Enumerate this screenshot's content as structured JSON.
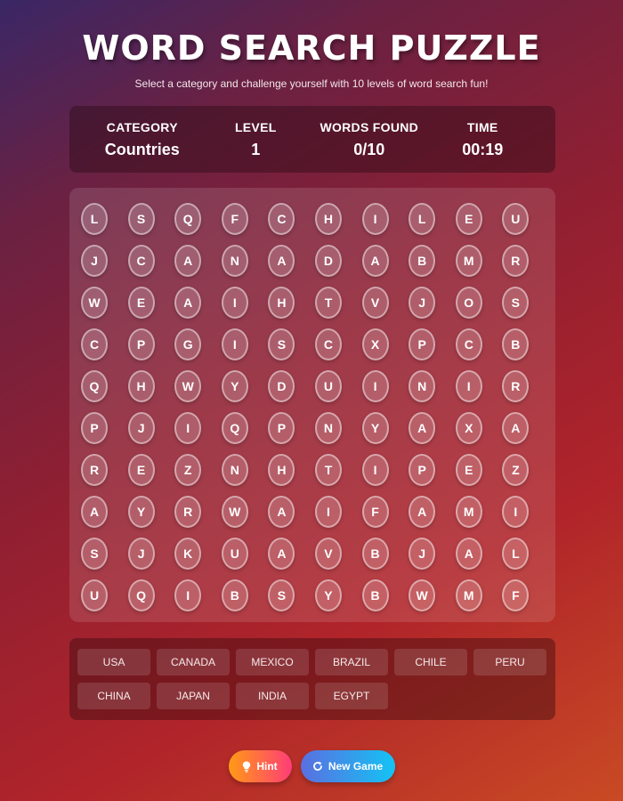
{
  "header": {
    "title": "WORD SEARCH PUZZLE",
    "subtitle": "Select a category and challenge yourself with 10 levels of word search fun!"
  },
  "stats": {
    "category_label": "CATEGORY",
    "category_value": "Countries",
    "level_label": "LEVEL",
    "level_value": "1",
    "words_found_label": "WORDS FOUND",
    "words_found_value": "0/10",
    "time_label": "TIME",
    "time_value": "00:19"
  },
  "grid": [
    [
      "L",
      "S",
      "Q",
      "F",
      "C",
      "H",
      "I",
      "L",
      "E",
      "U"
    ],
    [
      "J",
      "C",
      "A",
      "N",
      "A",
      "D",
      "A",
      "B",
      "M",
      "R"
    ],
    [
      "W",
      "E",
      "A",
      "I",
      "H",
      "T",
      "V",
      "J",
      "O",
      "S"
    ],
    [
      "C",
      "P",
      "G",
      "I",
      "S",
      "C",
      "X",
      "P",
      "C",
      "B"
    ],
    [
      "Q",
      "H",
      "W",
      "Y",
      "D",
      "U",
      "I",
      "N",
      "I",
      "R"
    ],
    [
      "P",
      "J",
      "I",
      "Q",
      "P",
      "N",
      "Y",
      "A",
      "X",
      "A"
    ],
    [
      "R",
      "E",
      "Z",
      "N",
      "H",
      "T",
      "I",
      "P",
      "E",
      "Z"
    ],
    [
      "A",
      "Y",
      "R",
      "W",
      "A",
      "I",
      "F",
      "A",
      "M",
      "I"
    ],
    [
      "S",
      "J",
      "K",
      "U",
      "A",
      "V",
      "B",
      "J",
      "A",
      "L"
    ],
    [
      "U",
      "Q",
      "I",
      "B",
      "S",
      "Y",
      "B",
      "W",
      "M",
      "F"
    ]
  ],
  "words": [
    "USA",
    "CANADA",
    "MEXICO",
    "BRAZIL",
    "CHILE",
    "PERU",
    "CHINA",
    "JAPAN",
    "INDIA",
    "EGYPT"
  ],
  "buttons": {
    "hint_label": "Hint",
    "new_game_label": "New Game"
  },
  "icons": {
    "hint": "lightbulb-icon",
    "new_game": "refresh-icon"
  }
}
